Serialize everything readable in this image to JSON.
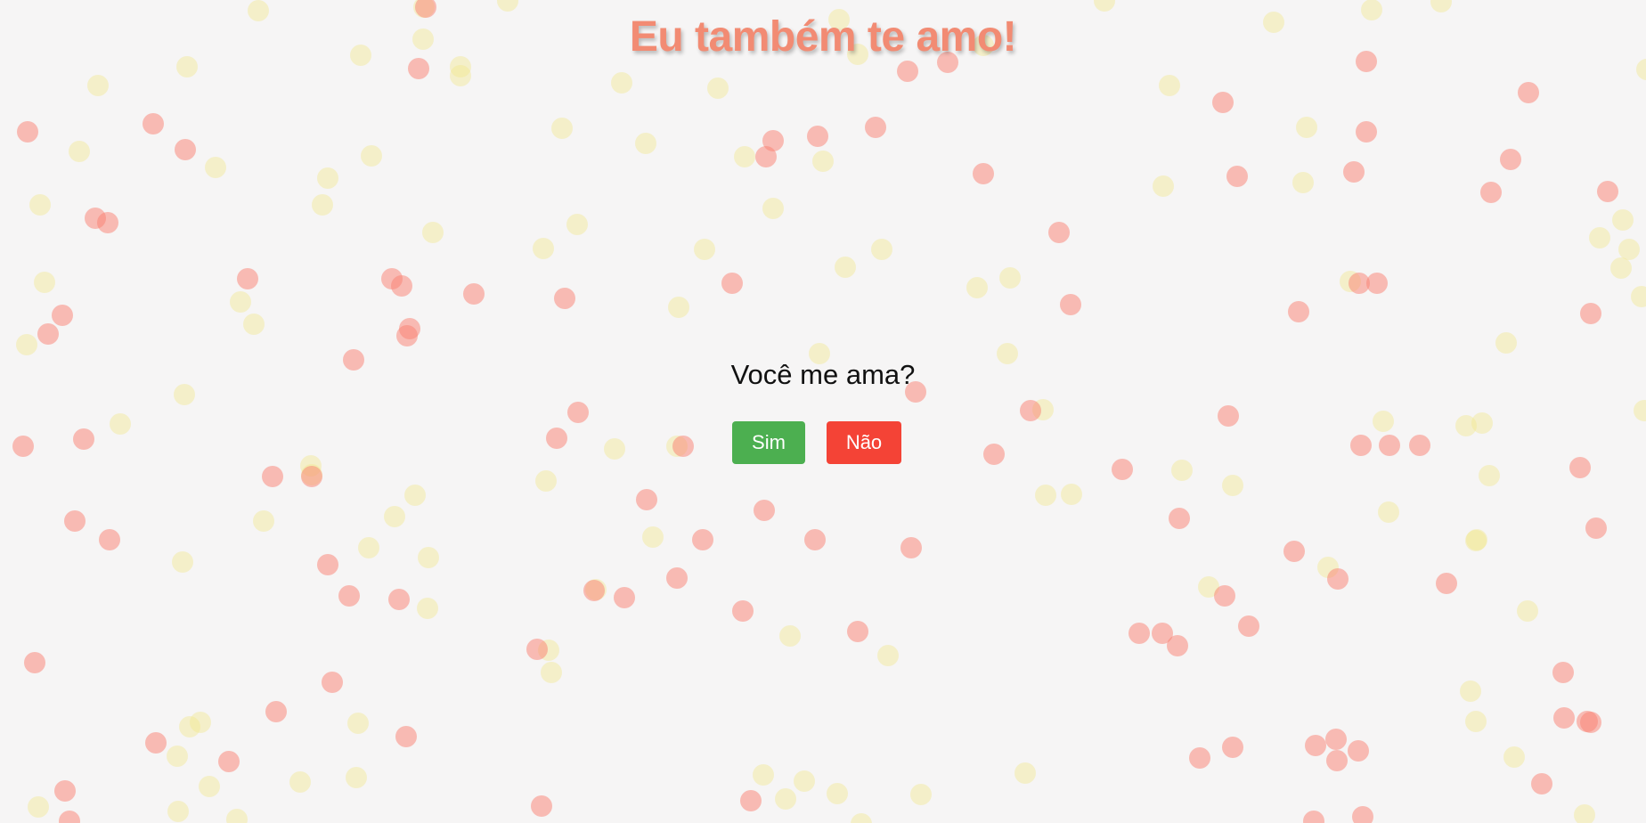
{
  "colors": {
    "background": "#f6f5f5",
    "heart_red": "rgba(250,128,114,0.5)",
    "heart_yellow": "rgba(240,230,140,0.42)",
    "title": "#f28b73",
    "yes_button": "#4caf50",
    "no_button": "#f44336"
  },
  "page": {
    "title": "Eu também te amo!",
    "question": "Você me ama?",
    "yes_label": "Sim",
    "no_label": "Não"
  }
}
